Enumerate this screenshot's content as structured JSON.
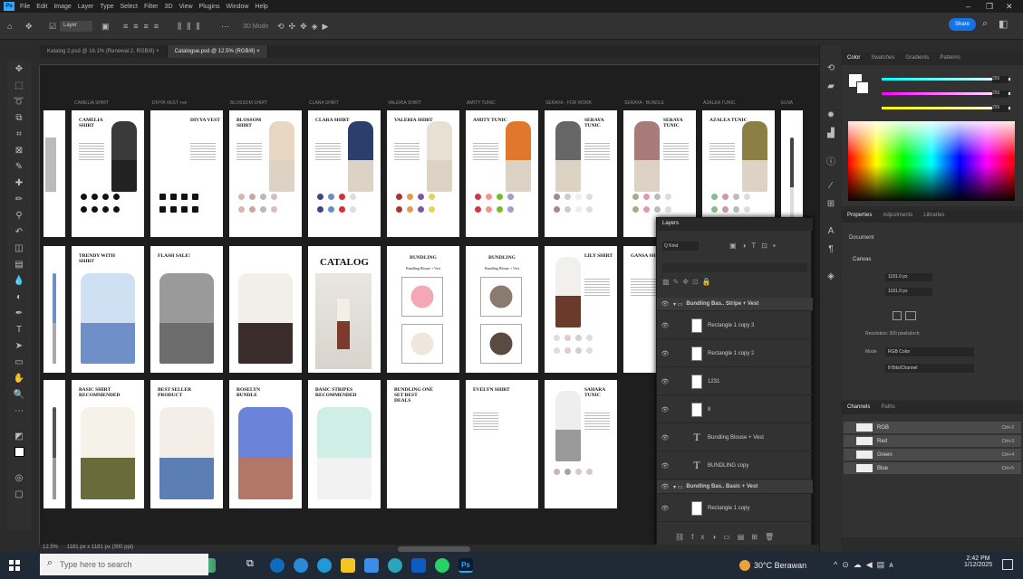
{
  "menubar": {
    "items": [
      "File",
      "Edit",
      "Image",
      "Layer",
      "Type",
      "Select",
      "Filter",
      "3D",
      "View",
      "Plugins",
      "Window",
      "Help"
    ]
  },
  "options": {
    "zoom_mode": "Layer",
    "share_label": "Share"
  },
  "doc_tabs": [
    {
      "label": "Katalog 2.psd @ 16.1% (Renewal 2, RGB/8) ×",
      "active": false
    },
    {
      "label": "Catalogue.psd @ 12.5% (RGB/8) ×",
      "active": true
    }
  ],
  "artboards": {
    "row1_titles": [
      "CAMELIA SHIRT",
      "DIVYA VEST +ve",
      "BLOSSOM SHIRT",
      "CLARA SHIRT",
      "VALERIA SHIRT",
      "AMITY TUNIC",
      "SERAYA - FOR WORK",
      "SERAYA - BUNDLE",
      "AZALEA TUNIC",
      "ELNA"
    ],
    "row1_cards": [
      "CAMELIA SHIRT",
      "DIVYA VEST",
      "BLOSSOM SHIRT",
      "CLARA SHIRT",
      "VALERIA SHIRT",
      "AMITY TUNIC",
      "SERAYA TUNIC",
      "SERAYA TUNIC",
      "AZALEA TUNIC"
    ],
    "row2_cards": [
      "TRENDY WITH SHIRT",
      "FLASH SALE!",
      "",
      "CATALOG",
      "BUNDLING",
      "BUNDLING",
      "LILY SHIRT",
      "GANSA SHIRT"
    ],
    "row2_subtitle": "Bundling Blouse + Vest",
    "row3_cards": [
      "BASIC SHIRT RECOMMENDED",
      "BEST SELLER PRODUCT",
      "ROSELYN BUNDLE",
      "BASIC STRIPES RECOMMENDED",
      "BUNDLING ONE SET BEST DEALS",
      "EVELYN SHIRT",
      "SAHARA TUNIC"
    ]
  },
  "colors": {
    "accent": "#31a8ff",
    "share": "#1473e6",
    "canvas": "#1e1e1e",
    "panel": "#323232"
  },
  "color_panel": {
    "tabs": [
      "Color",
      "Swatches",
      "Gradients",
      "Patterns"
    ],
    "values": [
      "255",
      "255",
      "255"
    ]
  },
  "properties_panel": {
    "tabs": [
      "Properties",
      "Adjustments",
      "Libraries"
    ],
    "doc_label": "Document",
    "canvas_label": "Canvas",
    "w": "1181.0 px",
    "h": "1181.0 px",
    "resolution": "Resolution: 300 pixels/inch",
    "mode_label": "Mode",
    "mode_value": "RGB Color",
    "bits": "8 Bits/Channel"
  },
  "channels_panel": {
    "tabs": [
      "Channels",
      "Paths"
    ],
    "rows": [
      {
        "name": "RGB",
        "key": "Ctrl+2"
      },
      {
        "name": "Red",
        "key": "Ctrl+3"
      },
      {
        "name": "Green",
        "key": "Ctrl+4"
      },
      {
        "name": "Blue",
        "key": "Ctrl+5"
      }
    ]
  },
  "layers_panel": {
    "title": "Layers",
    "kind": "Q Kind",
    "rows": [
      {
        "type": "group",
        "name": "Bundling Bas.. Stripe + Vest"
      },
      {
        "type": "image",
        "name": "Rectangle 1 copy 3"
      },
      {
        "type": "image",
        "name": "Rectangle 1 copy 2"
      },
      {
        "type": "image",
        "name": "1231"
      },
      {
        "type": "image",
        "name": "8"
      },
      {
        "type": "text",
        "name": "Bundling Blouse + Vest"
      },
      {
        "type": "text",
        "name": "BUNDLING copy"
      },
      {
        "type": "group",
        "name": "Bundling Bas.. Basic + Vest"
      },
      {
        "type": "image",
        "name": "Rectangle 1 copy"
      }
    ]
  },
  "status_bar": {
    "zoom": "12.5%",
    "doc_info": "1181 px x 1181 px (300 ppi)"
  },
  "taskbar": {
    "search_placeholder": "Type here to search",
    "weather": "30°C Berawan",
    "time": "2:42 PM",
    "date": "1/12/2025"
  }
}
